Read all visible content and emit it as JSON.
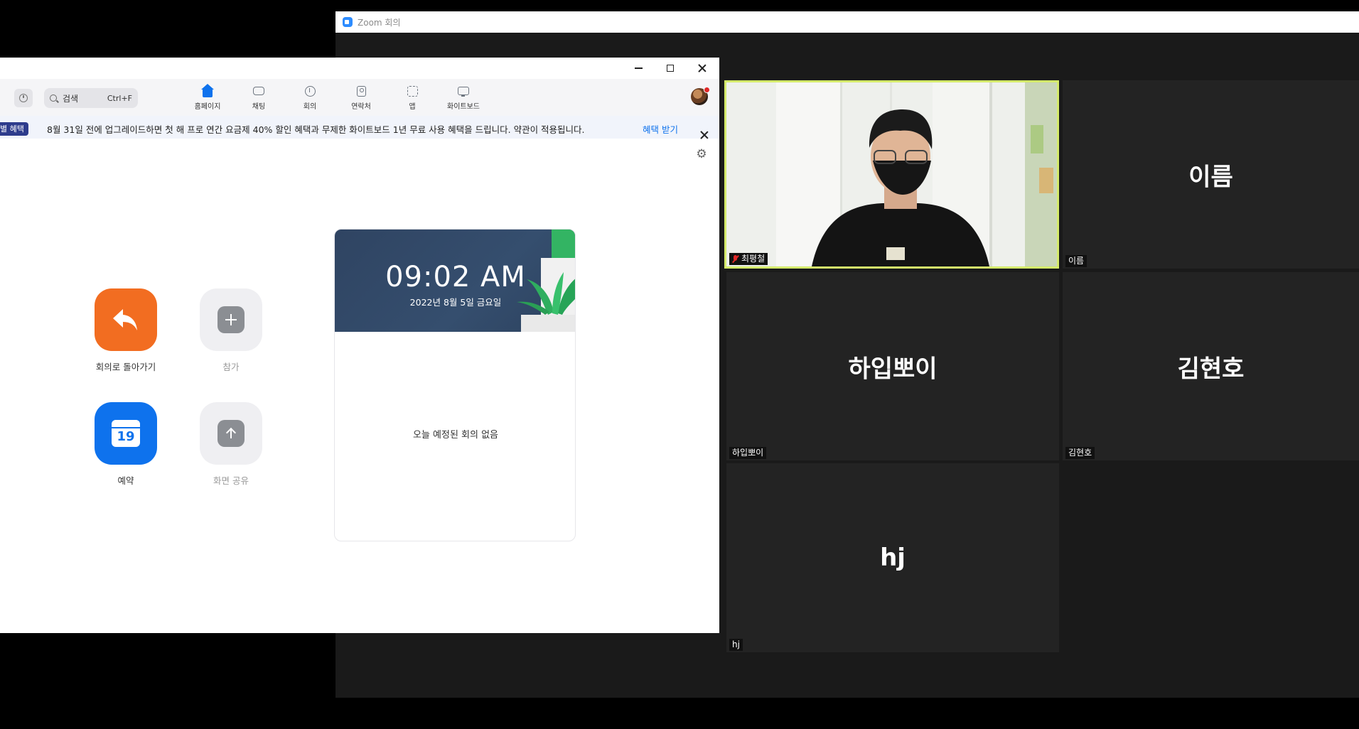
{
  "meeting_window": {
    "title": "Zoom 회의",
    "participants": [
      {
        "display_name": "",
        "tag": "최평철",
        "muted": true,
        "video": true
      },
      {
        "display_name": "이름",
        "tag": "이름"
      },
      {
        "display_name": "하입뽀이",
        "tag": "하입뽀이"
      },
      {
        "display_name": "김현호",
        "tag": "김현호"
      },
      {
        "display_name": "hj",
        "tag": "hj"
      }
    ],
    "colors": {
      "active_speaker_border": "#d4ea6b",
      "tile_bg": "#232323",
      "muted_mic": "#e02828"
    }
  },
  "home_window": {
    "search": {
      "placeholder": "검색",
      "shortcut": "Ctrl+F"
    },
    "tabs": [
      {
        "label": "홈페이지",
        "icon": "home-icon",
        "active": true
      },
      {
        "label": "채팅",
        "icon": "chat-icon"
      },
      {
        "label": "회의",
        "icon": "clock-icon"
      },
      {
        "label": "연락처",
        "icon": "contacts-icon"
      },
      {
        "label": "앱",
        "icon": "apps-icon"
      },
      {
        "label": "화이트보드",
        "icon": "whiteboard-icon"
      }
    ],
    "promo": {
      "badge": "별 혜택",
      "text": "8월 31일 전에 업그레이드하면 첫 해 프로 연간 요금제 40% 할인 혜택과 무제한 화이트보드 1년 무료 사용 혜택을 드립니다. 약관이 적용됩니다.",
      "link": "혜택 받기"
    },
    "actions": [
      {
        "label": "회의로 돌아가기",
        "icon": "return-arrow-icon",
        "color": "#f26d21"
      },
      {
        "label": "참가",
        "icon": "plus-icon"
      },
      {
        "label": "예약",
        "icon": "calendar-icon",
        "calendar_day": "19",
        "color": "#0e72ed"
      },
      {
        "label": "화면 공유",
        "icon": "share-arrow-icon"
      }
    ],
    "calendar_card": {
      "time": "09:02 AM",
      "date": "2022년 8월 5일 금요일",
      "empty_message": "오늘 예정된 회의 없음"
    },
    "colors": {
      "accent": "#0e72ed",
      "promo_badge": "#2e3c8c"
    }
  }
}
